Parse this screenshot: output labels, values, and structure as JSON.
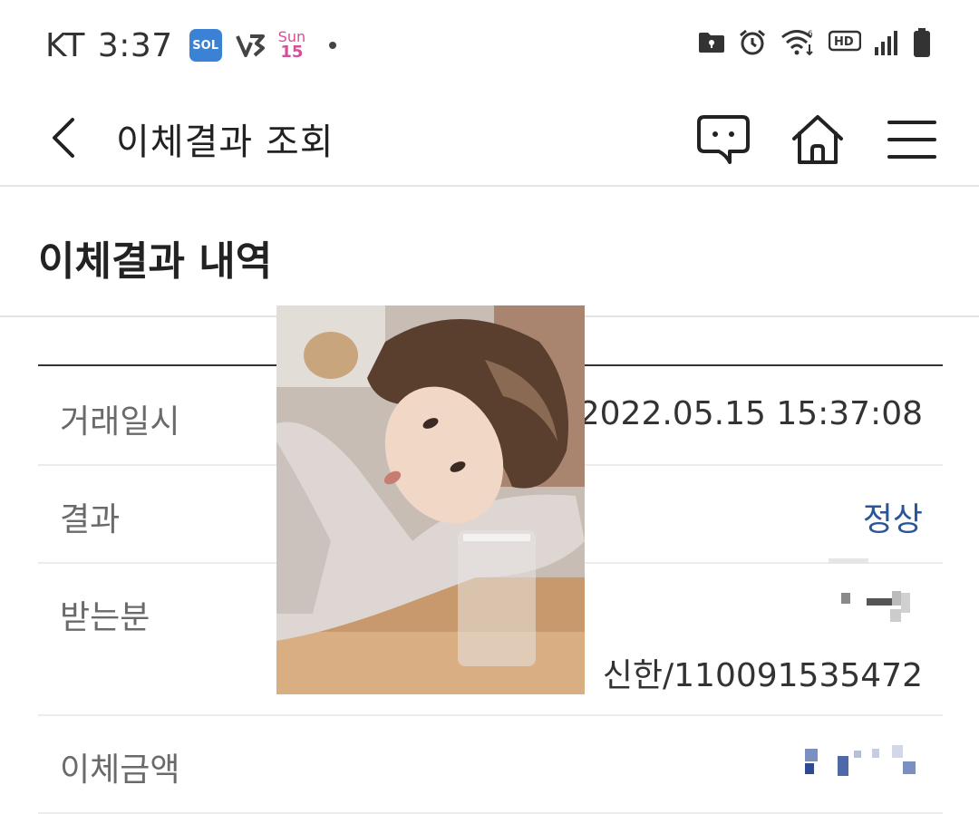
{
  "status_bar": {
    "carrier": "KT",
    "time": "3:37",
    "sol_badge": "SOL",
    "calendar_day": "Sun",
    "calendar_date": "15",
    "right_icons": [
      "folder-lock-icon",
      "alarm-icon",
      "wifi-icon",
      "hd-icon",
      "signal-icon",
      "battery-icon"
    ],
    "hd_text": "HD"
  },
  "app_bar": {
    "title": "이체결과 조회",
    "icons": [
      "back-chevron-icon",
      "chat-icon",
      "home-icon",
      "menu-icon"
    ]
  },
  "section": {
    "heading": "이체결과 내역"
  },
  "details": {
    "date_label": "거래일시",
    "date_value": "2022.05.15 15:37:08",
    "result_label": "결과",
    "result_value": "정상",
    "recipient_label": "받는분",
    "recipient_account": "신한/110091535472",
    "amount_label": "이체금액"
  },
  "colors": {
    "accent_blue": "#2a5599",
    "sol_badge": "#3b82d6",
    "calendar_pink": "#d44f9a"
  }
}
